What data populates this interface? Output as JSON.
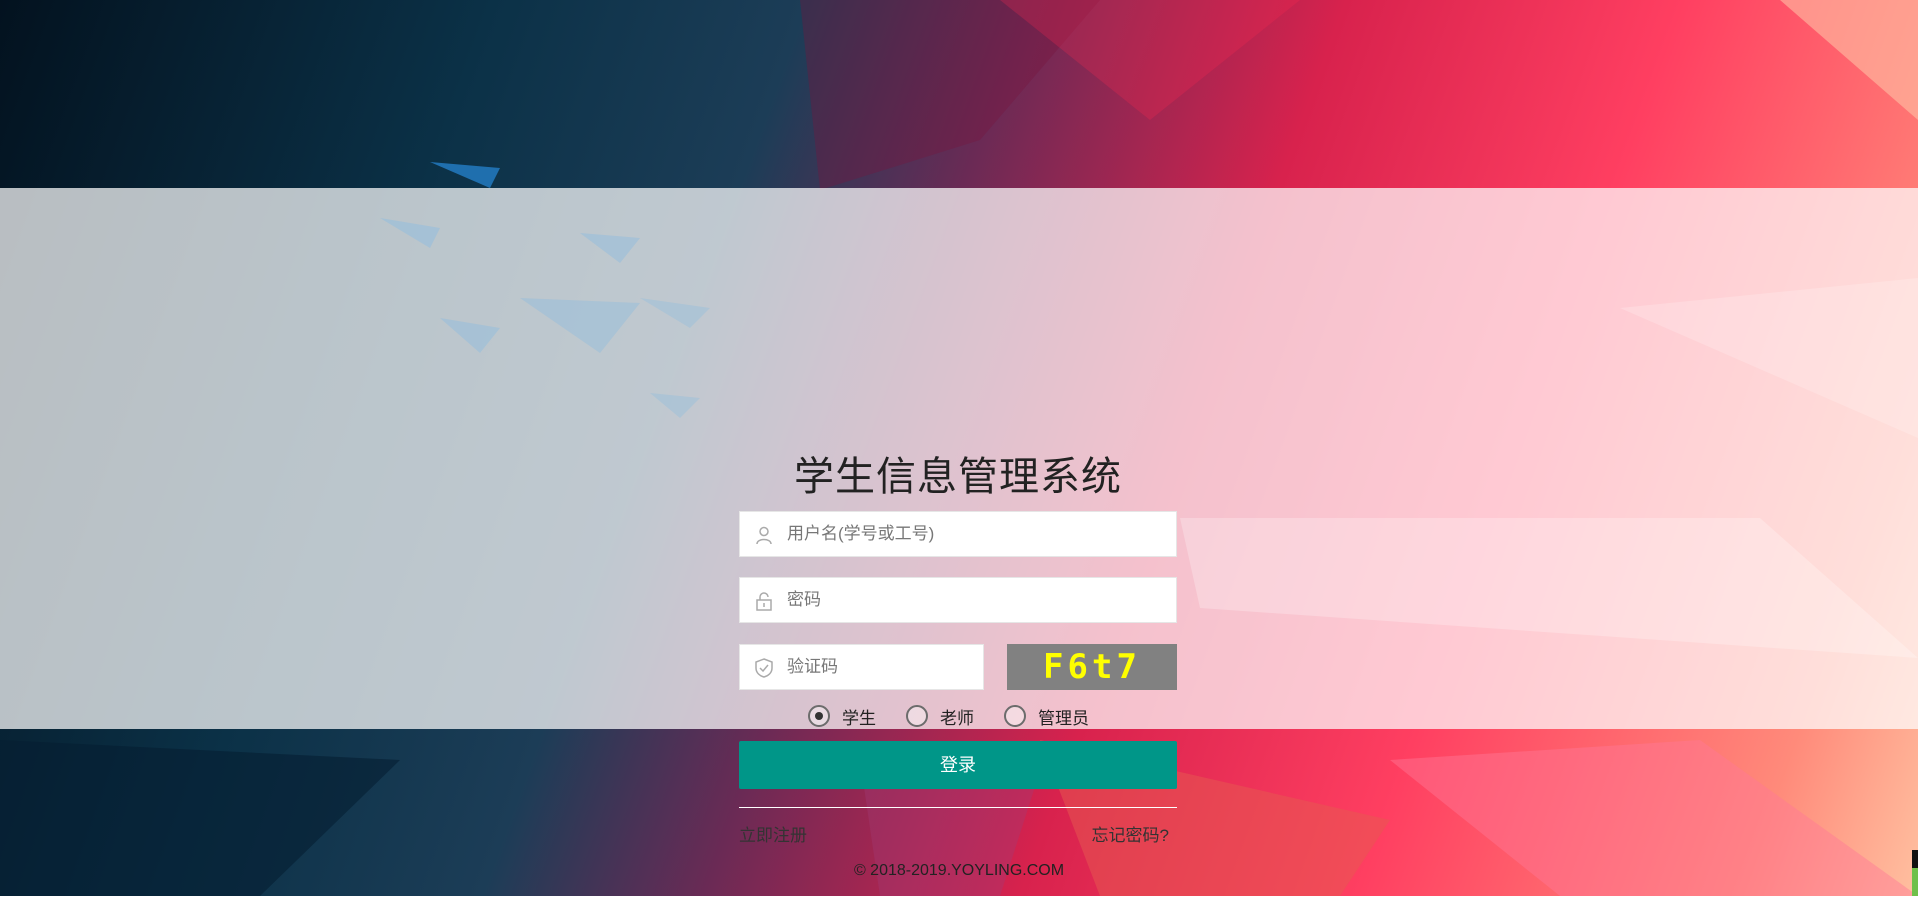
{
  "app": {
    "title": "学生信息管理系统"
  },
  "form": {
    "username": {
      "placeholder": "用户名(学号或工号)",
      "icon": "user-icon"
    },
    "password": {
      "placeholder": "密码",
      "icon": "lock-icon"
    },
    "captcha": {
      "placeholder": "验证码",
      "icon": "shield-icon",
      "code": "F6t7"
    },
    "roles": [
      {
        "label": "学生",
        "selected": true
      },
      {
        "label": "老师",
        "selected": false
      },
      {
        "label": "管理员",
        "selected": false
      }
    ],
    "login_label": "登录",
    "register_link": "立即注册",
    "forgot_link": "忘记密码?"
  },
  "footer": {
    "copyright": "© 2018-2019.YOYLING.COM"
  },
  "colors": {
    "primary": "#009688",
    "captcha_bg": "#818181",
    "captcha_text": "#ffff00"
  }
}
